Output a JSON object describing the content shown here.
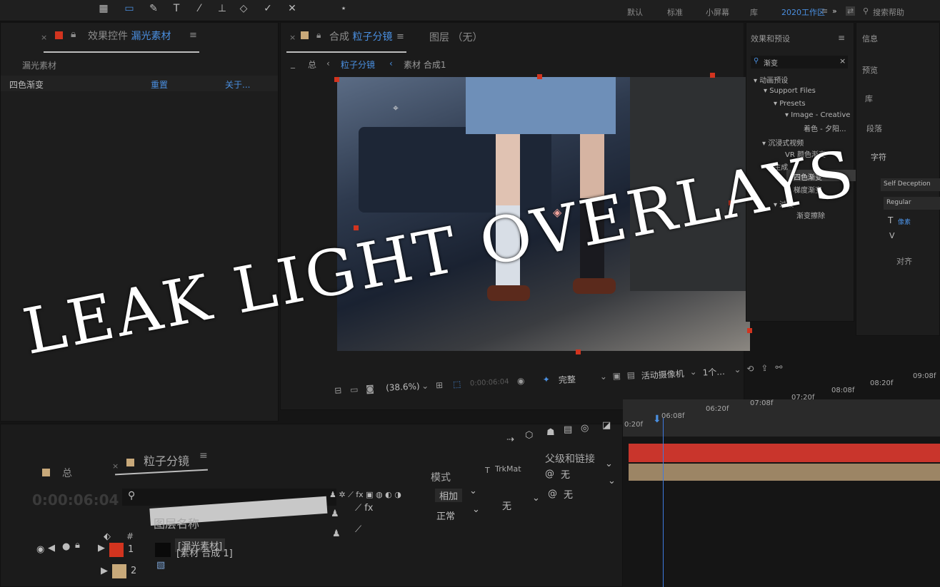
{
  "toolbar": {
    "workspaces": [
      "默认",
      "标准",
      "小屏幕",
      "库",
      "2020工作区"
    ],
    "search_placeholder": "搜索帮助",
    "overflow": "»"
  },
  "effect_controls": {
    "tab_prefix": "效果控件",
    "tab_layer": "漏光素材",
    "breadcrumb": "漏光素材",
    "effect_name": "四色渐变",
    "reset": "重置",
    "about": "关于..."
  },
  "composition": {
    "tab_prefix": "合成",
    "tab_name": "粒子分镜",
    "layer_tab": "图层 （无）",
    "nav_root": "总",
    "nav_current": "粒子分镜",
    "nav_child": "素材 合成1",
    "zoom": "(38.6%)",
    "timecode": "0:00:06:04",
    "resolution": "完整",
    "camera": "活动摄像机",
    "views": "1个..."
  },
  "effects_presets": {
    "title": "效果和预设",
    "search_value": "渐变",
    "items": [
      "▾ 动画预设",
      "▾ Support Files",
      "▾ Presets",
      "▾ Image - Creative",
      "着色 - 夕阳...",
      "▾ 沉浸式视频",
      "VR 颜色渐变",
      "▾ 生成",
      "四色渐变",
      "梯度渐变",
      "▾ 过渡",
      "渐变擦除"
    ]
  },
  "side_panels": {
    "info": "信息",
    "preview": "预览",
    "library": "库",
    "paragraph": "段落",
    "character": "字符",
    "font": "Self Deception",
    "style": "Regular",
    "size_label": "像素",
    "align": "对齐"
  },
  "timeline": {
    "tab_root": "总",
    "tab_name": "粒子分镜",
    "timecode": "0:00:06:04",
    "col_name": "图层名称",
    "col_mode": "模式",
    "col_t": "T",
    "col_trkmat": "TrkMat",
    "col_parent": "父级和链接",
    "ruler": [
      "0:20f",
      "06:08f",
      "06:20f",
      "07:08f",
      "07:20f",
      "08:08f",
      "08:20f",
      "09:08f"
    ],
    "layers": [
      {
        "num": "1",
        "name": "[漏光素材]",
        "color": "#d2341f",
        "mode": "相加",
        "trkmat": "",
        "parent": "无"
      },
      {
        "num": "2",
        "name": "[素材 合成 1]",
        "color": "#c8a97a",
        "mode": "正常",
        "trkmat": "无",
        "parent": "无"
      }
    ]
  },
  "overlay": {
    "title": "LEAK LIGHT OVERLAYS"
  },
  "colors": {
    "accent": "#4a8fe0",
    "layer_red": "#c9352c",
    "layer_tan": "#9c8565"
  }
}
